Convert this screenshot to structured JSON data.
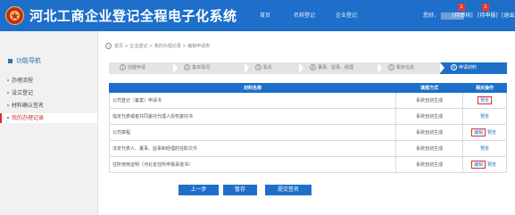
{
  "header": {
    "title": "河北工商企业登记全程电子化系统",
    "nav": [
      "首页",
      "名称登记",
      "企业登记"
    ],
    "greeting": "您好，",
    "pending_approval": "[待审核]",
    "pending_declare": "[待申报]",
    "logout": "[退出",
    "badge_approval": "1",
    "badge_declare": "1"
  },
  "sidebar": {
    "heading": "功能导航",
    "items": [
      {
        "label": "办理流程",
        "active": false
      },
      {
        "label": "设立登记",
        "active": false
      },
      {
        "label": "材料确认签名",
        "active": false
      },
      {
        "label": "我的办理记录",
        "active": true
      }
    ]
  },
  "breadcrumb": "首页 > 企业登记 > 我的办理记录 > 编辑申请表",
  "steps": [
    {
      "num": "1",
      "label": "创建申请"
    },
    {
      "num": "2",
      "label": "基本情况"
    },
    {
      "num": "3",
      "label": "股东"
    },
    {
      "num": "4",
      "label": "董事、监事、经理"
    },
    {
      "num": "5",
      "label": "税务信息"
    },
    {
      "num": "6",
      "label": "申请材料"
    }
  ],
  "table": {
    "headers": [
      "材料名称",
      "填报方式",
      "相关操作"
    ],
    "rows": [
      {
        "name": "公司登记（备案）申请书",
        "method": "系统自动生成",
        "ops": [
          "预览"
        ]
      },
      {
        "name": "指定代表或者共同委托代理人授权委托书",
        "method": "系统自动生成",
        "ops": [
          "预览"
        ]
      },
      {
        "name": "公司章程",
        "method": "系统自动生成",
        "ops": [
          "编辑",
          "预览"
        ]
      },
      {
        "name": "法定代表人、董事、监事和经理的任职文件",
        "method": "系统自动生成",
        "ops": [
          "预览"
        ]
      },
      {
        "name": "住所使用证明（河北省住所申报承诺书）",
        "method": "系统自动生成",
        "ops": [
          "编辑",
          "预览"
        ]
      }
    ]
  },
  "buttons": {
    "prev": "上一步",
    "save": "暂存",
    "submit": "提交签名"
  },
  "colors": {
    "primary": "#1d6fc9",
    "active_red": "#d32f2f"
  }
}
